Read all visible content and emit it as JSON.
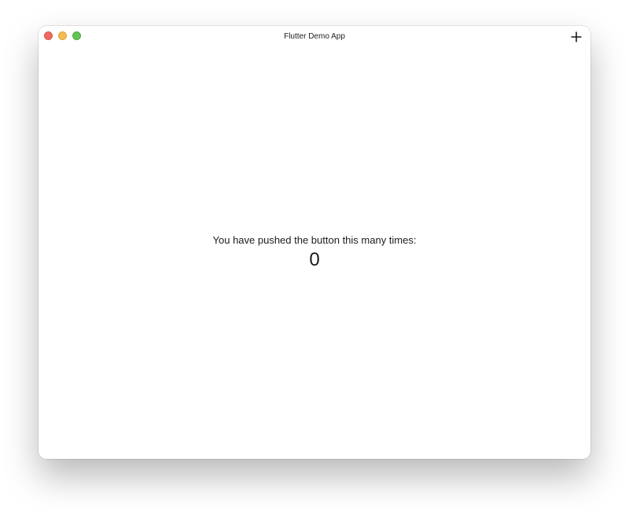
{
  "window": {
    "title": "Flutter Demo App"
  },
  "toolbar": {
    "add_icon": "plus-icon"
  },
  "traffic_lights": {
    "close_color": "#ee6a5f",
    "minimize_color": "#f5bd4f",
    "maximize_color": "#61c454"
  },
  "main": {
    "message": "You have pushed the button this many times:",
    "counter": "0"
  }
}
